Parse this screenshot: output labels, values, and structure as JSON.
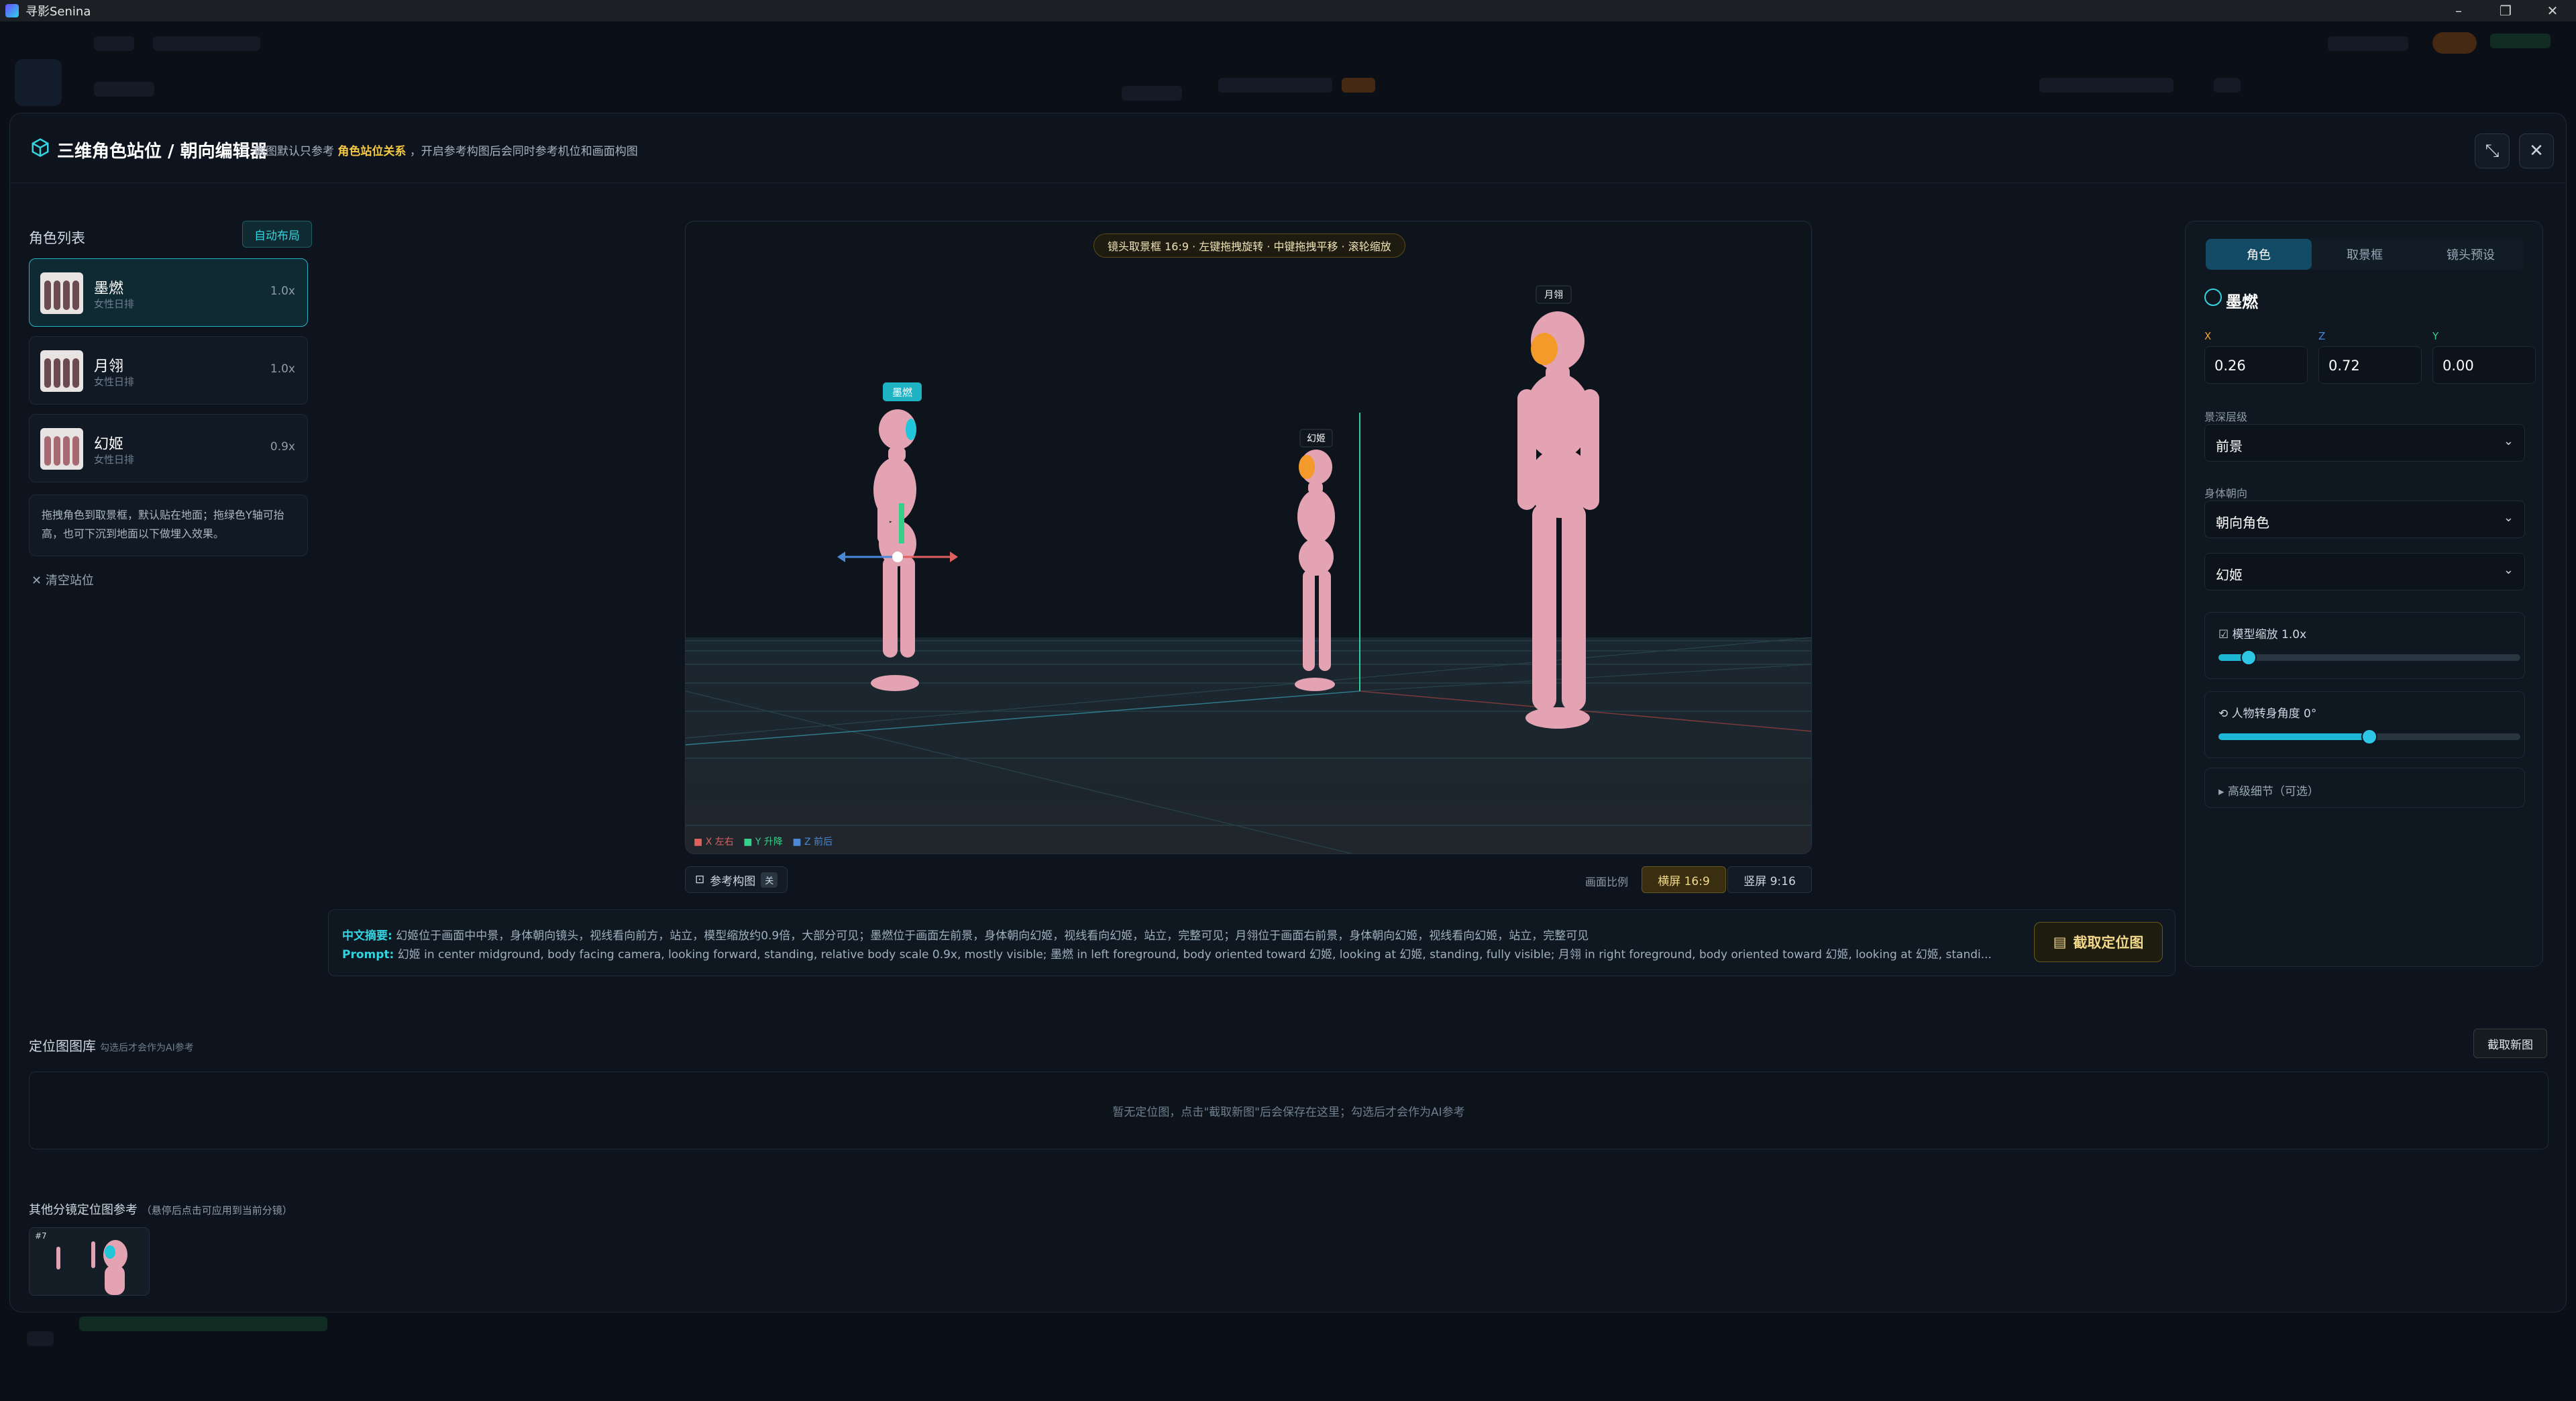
{
  "os": {
    "app_title": "寻影Senina"
  },
  "modal": {
    "title": "三维角色站位 / 朝向编辑器",
    "subtitle_pre": "截图默认只参考",
    "subtitle_highlight": "角色站位关系",
    "subtitle_post": "，开启参考构图后会同时参考机位和画面构图"
  },
  "left": {
    "list_label": "角色列表",
    "auto_layout": "自动布局",
    "characters": [
      {
        "name": "墨燃",
        "role": "女性日排",
        "scale": "1.0x"
      },
      {
        "name": "月翎",
        "role": "女性日排",
        "scale": "1.0x"
      },
      {
        "name": "幻姬",
        "role": "女性日排",
        "scale": "0.9x"
      }
    ],
    "tip": "拖拽角色到取景框，默认贴在地面；拖绿色Y轴可抬高，也可下沉到地面以下做埋入效果。",
    "clear": "清空站位"
  },
  "viewport": {
    "hint": "镜头取景框 16:9 · 左键拖拽旋转 · 中键拖拽平移 · 滚轮缩放",
    "labels": {
      "left": "墨燃",
      "center": "幻姬",
      "right": "月翎"
    },
    "axis_x": "X 左右",
    "axis_y": "Y 升降",
    "axis_z": "Z 前后",
    "ref_button": "参考构图",
    "ref_badge": "关",
    "ratio_label": "画面比例",
    "ratio_landscape": "横屏 16:9",
    "ratio_portrait": "竖屏 9:16"
  },
  "summary": {
    "cn_key": "中文摘要:",
    "cn_text": "幻姬位于画面中中景，身体朝向镜头，视线看向前方，站立，模型缩放约0.9倍，大部分可见；墨燃位于画面左前景，身体朝向幻姬，视线看向幻姬，站立，完整可见；月翎位于画面右前景，身体朝向幻姬，视线看向幻姬，站立，完整可见",
    "en_key": "Prompt:",
    "en_text": "幻姬 in center midground, body facing camera, looking forward, standing, relative body scale 0.9x, mostly visible; 墨燃 in left foreground, body oriented toward 幻姬, looking at 幻姬, standing, fully visible; 月翎 in right foreground, body oriented toward 幻姬, looking at 幻姬, standi...",
    "capture": "截取定位图"
  },
  "right": {
    "tabs": [
      "角色",
      "取景框",
      "镜头预设"
    ],
    "selected_name": "墨燃",
    "x_label": "X",
    "x_value": "0.26",
    "z_label": "Z",
    "z_value": "0.72",
    "y_label": "Y",
    "y_value": "0.00",
    "depth_label": "景深层级",
    "depth_value": "前景",
    "facing_label": "身体朝向",
    "facing_value": "朝向角色",
    "facing_target": "幻姬",
    "scale_label": "模型缩放 1.0x",
    "scale_fraction": 0.1,
    "rotate_label": "人物转身角度 0°",
    "rotate_fraction": 0.5,
    "advanced": "▸ 高级细节（可选）"
  },
  "gallery": {
    "label": "定位图图库",
    "label_hint": "勾选后才会作为AI参考",
    "new_capture": "截取新图",
    "empty": "暂无定位图，点击\"截取新图\"后会保存在这里；勾选后才会作为AI参考",
    "others_label": "其他分镜定位图参考",
    "others_hint": "（悬停后点击可应用到当前分镜）",
    "thumb_tag": "#7"
  }
}
